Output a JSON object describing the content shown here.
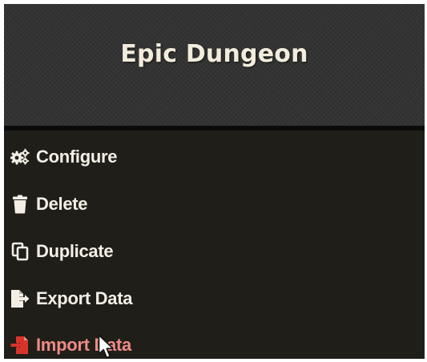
{
  "header": {
    "title": "Epic Dungeon"
  },
  "menu": {
    "items": [
      {
        "label": "Configure",
        "icon": "gears-icon"
      },
      {
        "label": "Delete",
        "icon": "trash-icon"
      },
      {
        "label": "Duplicate",
        "icon": "copy-icon"
      },
      {
        "label": "Export Data",
        "icon": "file-export-icon"
      },
      {
        "label": "Import Data",
        "icon": "file-import-icon",
        "highlighted": true
      }
    ]
  },
  "colors": {
    "header_bg": "#333333",
    "menu_bg": "#201e19",
    "text": "#f3efe6",
    "highlight_text": "#ee8a86",
    "import_icon": "#d9342b"
  }
}
